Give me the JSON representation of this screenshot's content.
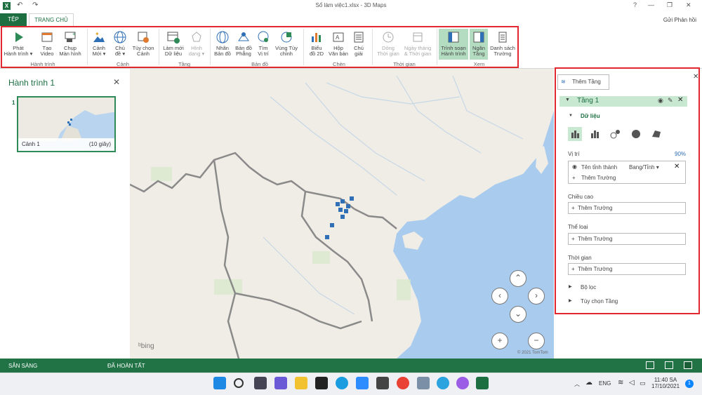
{
  "window": {
    "title": "Sổ làm việc1.xlsx - 3D Maps",
    "app_logo": "X",
    "help": "?",
    "minimize": "—",
    "restore": "❐",
    "close": "✕"
  },
  "tabs": {
    "file": "TỆP",
    "home": "TRANG CHỦ",
    "feedback": "Gửi Phản hồi"
  },
  "ribbon": {
    "groups": [
      {
        "label": "Hành trình"
      },
      {
        "label": "Cảnh"
      },
      {
        "label": "Tầng"
      },
      {
        "label": "Bản đồ"
      },
      {
        "label": "Chèn"
      },
      {
        "label": "Thời gian"
      },
      {
        "label": "Xem"
      }
    ],
    "buttons": {
      "play_tour": [
        "Phát",
        "Hành trình ▾"
      ],
      "create_video": [
        "Tạo",
        "Video"
      ],
      "screenshot": [
        "Chụp",
        "Màn hình"
      ],
      "new_scene": [
        "Cảnh",
        "Mới ▾"
      ],
      "themes": [
        "Chủ",
        "đề ▾"
      ],
      "scene_options": [
        "Tùy chọn",
        "Cảnh"
      ],
      "refresh_data": [
        "Làm mới",
        "Dữ liệu"
      ],
      "shapes": [
        "Hình",
        "dạng ▾"
      ],
      "map_labels": [
        "Nhãn",
        "Bản đồ"
      ],
      "flat_map": [
        "Bản đồ",
        "Phẳng"
      ],
      "find_location": [
        "Tìm",
        "Vị trí"
      ],
      "custom_regions": [
        "Vùng Tùy",
        "chỉnh"
      ],
      "chart_2d": [
        "Biểu",
        "đồ 2D"
      ],
      "text_box": [
        "Hộp",
        "Văn bản"
      ],
      "legend": [
        "Chú",
        "giải"
      ],
      "timeline": [
        "Dòng",
        "Thời gian"
      ],
      "date_time": [
        "Ngày tháng",
        "& Thời gian"
      ],
      "tour_editor": [
        "Trình soạn",
        "Hành trình"
      ],
      "layer_pane": [
        "Ngăn",
        "Tầng"
      ],
      "field_list": [
        "Danh sách",
        "Trường"
      ]
    }
  },
  "tour_pane": {
    "title": "Hành trình 1",
    "close": "✕",
    "scene_number": "1",
    "scene_name": "Cảnh 1",
    "scene_duration": "(10 giây)"
  },
  "map": {
    "bing": "bing",
    "copyright": "© 2021 TomTom",
    "nav": {
      "up": "⌃",
      "left": "‹",
      "right": "›",
      "down": "⌄",
      "zoom_in": "+",
      "zoom_out": "−"
    }
  },
  "layer_pane": {
    "close": "✕",
    "add_layer": "Thêm Tầng",
    "layer_name": "Tầng 1",
    "data_section": "Dữ liệu",
    "location_label": "Vị trí",
    "location_confidence": "90%",
    "location_field": "Tên tỉnh thành",
    "location_type": "Bang/Tỉnh ▾",
    "add_field": "Thêm Trường",
    "height_label": "Chiều cao",
    "category_label": "Thể loại",
    "time_label": "Thời gian",
    "filters": "Bộ lọc",
    "layer_options": "Tùy chọn Tầng"
  },
  "status": {
    "ready": "SẴN SÀNG",
    "done": "ĐÃ HOÀN TẤT"
  },
  "taskbar": {
    "language": "ENG",
    "time": "11:40 SA",
    "date": "17/10/2021",
    "notification_count": "1"
  }
}
